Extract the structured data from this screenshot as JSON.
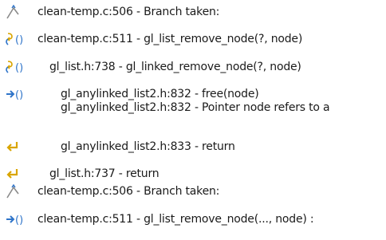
{
  "trace": {
    "items": [
      {
        "icon": "branch-icon",
        "text": "clean-temp.c:506 - Branch taken:"
      },
      {
        "icon": "call-icon",
        "text": "clean-temp.c:511 - gl_list_remove_node(?, node)"
      },
      {
        "icon": "call-icon",
        "text": "gl_list.h:738 - gl_linked_remove_node(?, node)"
      },
      {
        "icon": "enter-icon",
        "text": "gl_anylinked_list2.h:832 - free(node)",
        "text2": "gl_anylinked_list2.h:832 - Pointer node refers to a"
      },
      {
        "icon": "return-icon",
        "text": "gl_anylinked_list2.h:833 - return"
      },
      {
        "icon": "return-icon",
        "text": "gl_list.h:737 - return"
      },
      {
        "icon": "branch-icon",
        "text": "clean-temp.c:506 - Branch taken:"
      },
      {
        "icon": "enter-icon",
        "text": "clean-temp.c:511 - gl_list_remove_node(..., node) :"
      }
    ]
  },
  "colors": {
    "blue": "#2e74c9",
    "yellow": "#d9a500",
    "gray": "#8a8a8a",
    "text": "#1a1a1a"
  }
}
